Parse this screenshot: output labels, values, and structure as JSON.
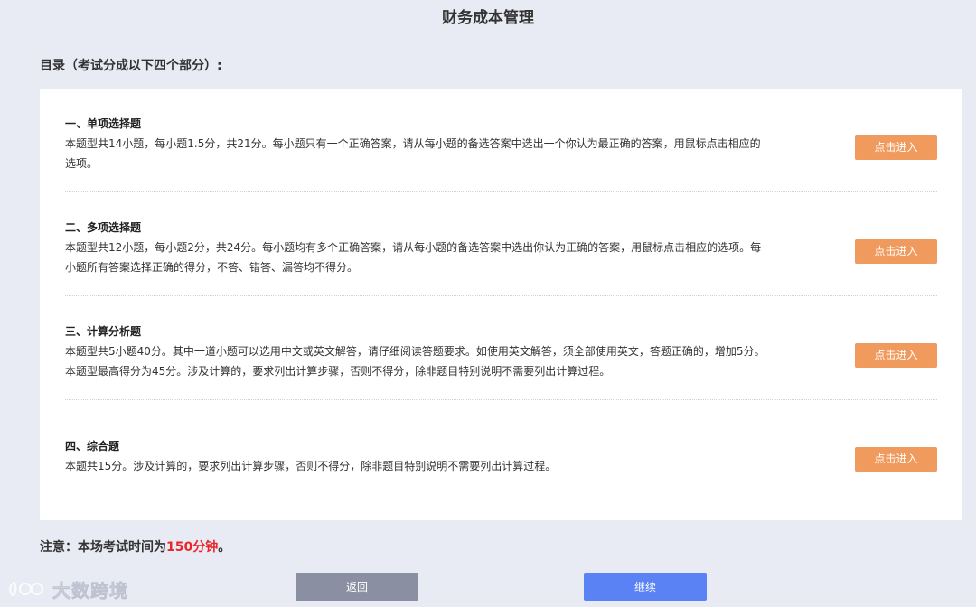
{
  "page": {
    "title": "财务成本管理",
    "toc_heading": "目录（考试分成以下四个部分）:"
  },
  "sections": [
    {
      "title": "一、单项选择题",
      "desc": "本题型共14小题，每小题1.5分，共21分。每小题只有一个正确答案，请从每小题的备选答案中选出一个你认为最正确的答案，用鼠标点击相应的选项。",
      "button": "点击进入"
    },
    {
      "title": "二、多项选择题",
      "desc": "本题型共12小题，每小题2分，共24分。每小题均有多个正确答案，请从每小题的备选答案中选出你认为正确的答案，用鼠标点击相应的选项。每小题所有答案选择正确的得分，不答、错答、漏答均不得分。",
      "button": "点击进入"
    },
    {
      "title": "三、计算分析题",
      "desc": "本题型共5小题40分。其中一道小题可以选用中文或英文解答，请仔细阅读答题要求。如使用英文解答，须全部使用英文，答题正确的，增加5分。本题型最高得分为45分。涉及计算的，要求列出计算步骤，否则不得分，除非题目特别说明不需要列出计算过程。",
      "button": "点击进入"
    },
    {
      "title": "四、综合题",
      "desc": "本题共15分。涉及计算的，要求列出计算步骤，否则不得分，除非题目特别说明不需要列出计算过程。",
      "button": "点击进入"
    }
  ],
  "notice": {
    "prefix": "注意：本场考试时间为",
    "highlight": "150分钟",
    "suffix": "。"
  },
  "footer": {
    "back_label": "返回",
    "continue_label": "继续"
  },
  "watermark": {
    "text": "大数跨境"
  },
  "colors": {
    "background": "#e8eaf4",
    "enter_button": "#f19a5e",
    "back_button": "#8a90a2",
    "continue_button": "#5b82f5",
    "highlight": "#e8262a"
  }
}
